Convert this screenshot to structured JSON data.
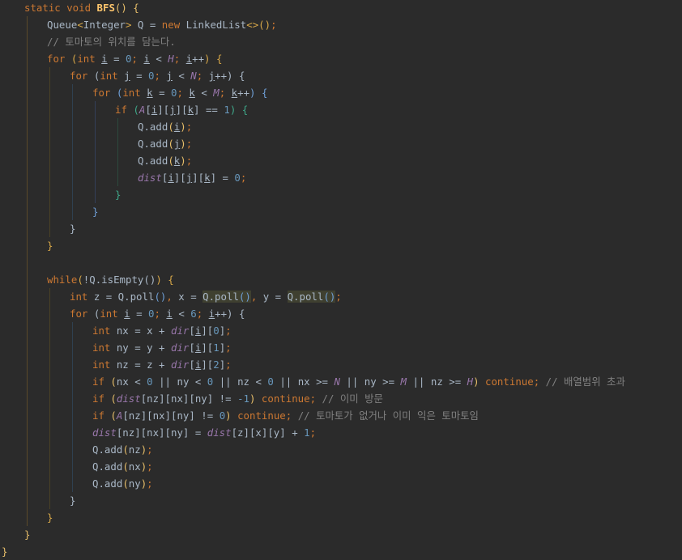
{
  "editor": {
    "colors": {
      "background": "#2b2b2b",
      "default": "#a9b7c6",
      "keyword": "#cc7832",
      "method": "#ffc66d",
      "number": "#6897bb",
      "comment": "#808080",
      "field": "#9876aa",
      "usage_highlight": "#3f4030"
    },
    "lines": [
      {
        "indent": 1,
        "tokens": [
          {
            "t": "static void ",
            "c": "kw"
          },
          {
            "t": "BFS",
            "c": "fn",
            "b": true
          },
          {
            "t": "() {",
            "c": "y0"
          }
        ]
      },
      {
        "indent": 2,
        "tokens": [
          {
            "t": "Queue",
            "c": "d"
          },
          {
            "t": "<",
            "c": "y1"
          },
          {
            "t": "Integer",
            "c": "d"
          },
          {
            "t": ">",
            "c": "y1"
          },
          {
            "t": " Q = ",
            "c": "d"
          },
          {
            "t": "new ",
            "c": "kw"
          },
          {
            "t": "LinkedList",
            "c": "d"
          },
          {
            "t": "<>",
            "c": "y1"
          },
          {
            "t": "()",
            "c": "y1"
          },
          {
            "t": ";",
            "c": "kw"
          }
        ]
      },
      {
        "indent": 2,
        "tokens": [
          {
            "t": "// 토마토의 위치를 담는다.",
            "c": "cm"
          }
        ]
      },
      {
        "indent": 2,
        "tokens": [
          {
            "t": "for ",
            "c": "kw"
          },
          {
            "t": "(",
            "c": "y1"
          },
          {
            "t": "int ",
            "c": "kw"
          },
          {
            "t": "i",
            "c": "d",
            "u": true
          },
          {
            "t": " = ",
            "c": "d"
          },
          {
            "t": "0",
            "c": "num"
          },
          {
            "t": "; ",
            "c": "kw"
          },
          {
            "t": "i",
            "c": "d",
            "u": true
          },
          {
            "t": " < ",
            "c": "d"
          },
          {
            "t": "H",
            "c": "f"
          },
          {
            "t": "; ",
            "c": "kw"
          },
          {
            "t": "i",
            "c": "d",
            "u": true
          },
          {
            "t": "++",
            "c": "d"
          },
          {
            "t": ") {",
            "c": "y1"
          }
        ]
      },
      {
        "indent": 3,
        "tokens": [
          {
            "t": "for ",
            "c": "kw"
          },
          {
            "t": "(",
            "c": "y2"
          },
          {
            "t": "int ",
            "c": "kw"
          },
          {
            "t": "j",
            "c": "d",
            "u": true
          },
          {
            "t": " = ",
            "c": "d"
          },
          {
            "t": "0",
            "c": "num"
          },
          {
            "t": "; ",
            "c": "kw"
          },
          {
            "t": "j",
            "c": "d",
            "u": true
          },
          {
            "t": " < ",
            "c": "d"
          },
          {
            "t": "N",
            "c": "f"
          },
          {
            "t": "; ",
            "c": "kw"
          },
          {
            "t": "j",
            "c": "d",
            "u": true
          },
          {
            "t": "++",
            "c": "d"
          },
          {
            "t": ") {",
            "c": "y2"
          }
        ]
      },
      {
        "indent": 4,
        "tokens": [
          {
            "t": "for ",
            "c": "kw"
          },
          {
            "t": "(",
            "c": "y3"
          },
          {
            "t": "int ",
            "c": "kw"
          },
          {
            "t": "k",
            "c": "d",
            "u": true
          },
          {
            "t": " = ",
            "c": "d"
          },
          {
            "t": "0",
            "c": "num"
          },
          {
            "t": "; ",
            "c": "kw"
          },
          {
            "t": "k",
            "c": "d",
            "u": true
          },
          {
            "t": " < ",
            "c": "d"
          },
          {
            "t": "M",
            "c": "f"
          },
          {
            "t": "; ",
            "c": "kw"
          },
          {
            "t": "k",
            "c": "d",
            "u": true
          },
          {
            "t": "++",
            "c": "d"
          },
          {
            "t": ") {",
            "c": "y3"
          }
        ]
      },
      {
        "indent": 5,
        "tokens": [
          {
            "t": "if ",
            "c": "kw"
          },
          {
            "t": "(",
            "c": "y4"
          },
          {
            "t": "A",
            "c": "f"
          },
          {
            "t": "[",
            "c": "d"
          },
          {
            "t": "i",
            "c": "d",
            "u": true
          },
          {
            "t": "][",
            "c": "d"
          },
          {
            "t": "j",
            "c": "d",
            "u": true
          },
          {
            "t": "][",
            "c": "d"
          },
          {
            "t": "k",
            "c": "d",
            "u": true
          },
          {
            "t": "] == ",
            "c": "d"
          },
          {
            "t": "1",
            "c": "num"
          },
          {
            "t": ") {",
            "c": "y4"
          }
        ]
      },
      {
        "indent": 6,
        "tokens": [
          {
            "t": "Q.add",
            "c": "d"
          },
          {
            "t": "(",
            "c": "y0"
          },
          {
            "t": "i",
            "c": "d",
            "u": true
          },
          {
            "t": ")",
            "c": "y0"
          },
          {
            "t": ";",
            "c": "kw"
          }
        ]
      },
      {
        "indent": 6,
        "tokens": [
          {
            "t": "Q.add",
            "c": "d"
          },
          {
            "t": "(",
            "c": "y0"
          },
          {
            "t": "j",
            "c": "d",
            "u": true
          },
          {
            "t": ")",
            "c": "y0"
          },
          {
            "t": ";",
            "c": "kw"
          }
        ]
      },
      {
        "indent": 6,
        "tokens": [
          {
            "t": "Q.add",
            "c": "d"
          },
          {
            "t": "(",
            "c": "y0"
          },
          {
            "t": "k",
            "c": "d",
            "u": true
          },
          {
            "t": ")",
            "c": "y0"
          },
          {
            "t": ";",
            "c": "kw"
          }
        ]
      },
      {
        "indent": 6,
        "tokens": [
          {
            "t": "dist",
            "c": "f"
          },
          {
            "t": "[",
            "c": "d"
          },
          {
            "t": "i",
            "c": "d",
            "u": true
          },
          {
            "t": "][",
            "c": "d"
          },
          {
            "t": "j",
            "c": "d",
            "u": true
          },
          {
            "t": "][",
            "c": "d"
          },
          {
            "t": "k",
            "c": "d",
            "u": true
          },
          {
            "t": "] = ",
            "c": "d"
          },
          {
            "t": "0",
            "c": "num"
          },
          {
            "t": ";",
            "c": "kw"
          }
        ]
      },
      {
        "indent": 5,
        "tokens": [
          {
            "t": "}",
            "c": "y4"
          }
        ]
      },
      {
        "indent": 4,
        "tokens": [
          {
            "t": "}",
            "c": "y3"
          }
        ]
      },
      {
        "indent": 3,
        "tokens": [
          {
            "t": "}",
            "c": "y2"
          }
        ]
      },
      {
        "indent": 2,
        "tokens": [
          {
            "t": "}",
            "c": "y1"
          }
        ]
      },
      {
        "indent": 0,
        "tokens": []
      },
      {
        "indent": 2,
        "tokens": [
          {
            "t": "while",
            "c": "kw"
          },
          {
            "t": "(",
            "c": "y1"
          },
          {
            "t": "!Q.isEmpty",
            "c": "d"
          },
          {
            "t": "()",
            "c": "y2"
          },
          {
            "t": ") {",
            "c": "y1"
          }
        ]
      },
      {
        "indent": 3,
        "tokens": [
          {
            "t": "int ",
            "c": "kw"
          },
          {
            "t": "z = Q.poll",
            "c": "d"
          },
          {
            "t": "()",
            "c": "y3"
          },
          {
            "t": ", ",
            "c": "kw"
          },
          {
            "t": "x = ",
            "c": "d"
          },
          {
            "t": "Q.poll",
            "c": "d",
            "h": true
          },
          {
            "t": "()",
            "c": "y3",
            "h": true
          },
          {
            "t": ", ",
            "c": "kw"
          },
          {
            "t": "y = ",
            "c": "d"
          },
          {
            "t": "Q.poll",
            "c": "d",
            "h": true
          },
          {
            "t": "()",
            "c": "y3",
            "h": true
          },
          {
            "t": ";",
            "c": "kw"
          }
        ]
      },
      {
        "indent": 3,
        "tokens": [
          {
            "t": "for ",
            "c": "kw"
          },
          {
            "t": "(",
            "c": "y2"
          },
          {
            "t": "int ",
            "c": "kw"
          },
          {
            "t": "i",
            "c": "d",
            "u": true
          },
          {
            "t": " = ",
            "c": "d"
          },
          {
            "t": "0",
            "c": "num"
          },
          {
            "t": "; ",
            "c": "kw"
          },
          {
            "t": "i",
            "c": "d",
            "u": true
          },
          {
            "t": " < ",
            "c": "d"
          },
          {
            "t": "6",
            "c": "num"
          },
          {
            "t": "; ",
            "c": "kw"
          },
          {
            "t": "i",
            "c": "d",
            "u": true
          },
          {
            "t": "++",
            "c": "d"
          },
          {
            "t": ") {",
            "c": "y2"
          }
        ]
      },
      {
        "indent": 4,
        "tokens": [
          {
            "t": "int ",
            "c": "kw"
          },
          {
            "t": "nx = x + ",
            "c": "d"
          },
          {
            "t": "dir",
            "c": "f"
          },
          {
            "t": "[",
            "c": "d"
          },
          {
            "t": "i",
            "c": "d",
            "u": true
          },
          {
            "t": "][",
            "c": "d"
          },
          {
            "t": "0",
            "c": "num"
          },
          {
            "t": "]",
            "c": "d"
          },
          {
            "t": ";",
            "c": "kw"
          }
        ]
      },
      {
        "indent": 4,
        "tokens": [
          {
            "t": "int ",
            "c": "kw"
          },
          {
            "t": "ny = y + ",
            "c": "d"
          },
          {
            "t": "dir",
            "c": "f"
          },
          {
            "t": "[",
            "c": "d"
          },
          {
            "t": "i",
            "c": "d",
            "u": true
          },
          {
            "t": "][",
            "c": "d"
          },
          {
            "t": "1",
            "c": "num"
          },
          {
            "t": "]",
            "c": "d"
          },
          {
            "t": ";",
            "c": "kw"
          }
        ]
      },
      {
        "indent": 4,
        "tokens": [
          {
            "t": "int ",
            "c": "kw"
          },
          {
            "t": "nz = z + ",
            "c": "d"
          },
          {
            "t": "dir",
            "c": "f"
          },
          {
            "t": "[",
            "c": "d"
          },
          {
            "t": "i",
            "c": "d",
            "u": true
          },
          {
            "t": "][",
            "c": "d"
          },
          {
            "t": "2",
            "c": "num"
          },
          {
            "t": "]",
            "c": "d"
          },
          {
            "t": ";",
            "c": "kw"
          }
        ]
      },
      {
        "indent": 4,
        "tokens": [
          {
            "t": "if ",
            "c": "kw"
          },
          {
            "t": "(",
            "c": "y0"
          },
          {
            "t": "nx < ",
            "c": "d"
          },
          {
            "t": "0",
            "c": "num"
          },
          {
            "t": " || ny < ",
            "c": "d"
          },
          {
            "t": "0",
            "c": "num"
          },
          {
            "t": " || nz < ",
            "c": "d"
          },
          {
            "t": "0",
            "c": "num"
          },
          {
            "t": " || nx >= ",
            "c": "d"
          },
          {
            "t": "N",
            "c": "f"
          },
          {
            "t": " || ny >= ",
            "c": "d"
          },
          {
            "t": "M",
            "c": "f"
          },
          {
            "t": " || nz >= ",
            "c": "d"
          },
          {
            "t": "H",
            "c": "f"
          },
          {
            "t": ") ",
            "c": "y0"
          },
          {
            "t": "continue",
            "c": "kw"
          },
          {
            "t": "; ",
            "c": "kw"
          },
          {
            "t": "// 배열범위 초과",
            "c": "cm"
          }
        ]
      },
      {
        "indent": 4,
        "tokens": [
          {
            "t": "if ",
            "c": "kw"
          },
          {
            "t": "(",
            "c": "y0"
          },
          {
            "t": "dist",
            "c": "f"
          },
          {
            "t": "[nz][nx][ny] != ",
            "c": "d"
          },
          {
            "t": "-1",
            "c": "num"
          },
          {
            "t": ") ",
            "c": "y0"
          },
          {
            "t": "continue",
            "c": "kw"
          },
          {
            "t": "; ",
            "c": "kw"
          },
          {
            "t": "// 이미 방문",
            "c": "cm"
          }
        ]
      },
      {
        "indent": 4,
        "tokens": [
          {
            "t": "if ",
            "c": "kw"
          },
          {
            "t": "(",
            "c": "y0"
          },
          {
            "t": "A",
            "c": "f"
          },
          {
            "t": "[nz][nx][ny] != ",
            "c": "d"
          },
          {
            "t": "0",
            "c": "num"
          },
          {
            "t": ") ",
            "c": "y0"
          },
          {
            "t": "continue",
            "c": "kw"
          },
          {
            "t": "; ",
            "c": "kw"
          },
          {
            "t": "// 토마토가 없거나 이미 익은 토마토임",
            "c": "cm"
          }
        ]
      },
      {
        "indent": 4,
        "tokens": [
          {
            "t": "dist",
            "c": "f"
          },
          {
            "t": "[nz][nx][ny] = ",
            "c": "d"
          },
          {
            "t": "dist",
            "c": "f"
          },
          {
            "t": "[z][x][y] + ",
            "c": "d"
          },
          {
            "t": "1",
            "c": "num"
          },
          {
            "t": ";",
            "c": "kw"
          }
        ]
      },
      {
        "indent": 4,
        "tokens": [
          {
            "t": "Q.add",
            "c": "d"
          },
          {
            "t": "(",
            "c": "y0"
          },
          {
            "t": "nz",
            "c": "d"
          },
          {
            "t": ")",
            "c": "y0"
          },
          {
            "t": ";",
            "c": "kw"
          }
        ]
      },
      {
        "indent": 4,
        "tokens": [
          {
            "t": "Q.add",
            "c": "d"
          },
          {
            "t": "(",
            "c": "y0"
          },
          {
            "t": "nx",
            "c": "d"
          },
          {
            "t": ")",
            "c": "y0"
          },
          {
            "t": ";",
            "c": "kw"
          }
        ]
      },
      {
        "indent": 4,
        "tokens": [
          {
            "t": "Q.add",
            "c": "d"
          },
          {
            "t": "(",
            "c": "y0"
          },
          {
            "t": "ny",
            "c": "d"
          },
          {
            "t": ")",
            "c": "y0"
          },
          {
            "t": ";",
            "c": "kw"
          }
        ]
      },
      {
        "indent": 3,
        "tokens": [
          {
            "t": "}",
            "c": "y2"
          }
        ]
      },
      {
        "indent": 2,
        "tokens": [
          {
            "t": "}",
            "c": "y1"
          }
        ]
      },
      {
        "indent": 1,
        "tokens": [
          {
            "t": "}",
            "c": "y0"
          }
        ]
      },
      {
        "indent": 0,
        "tokens": [
          {
            "t": "}",
            "c": "y0"
          }
        ]
      }
    ]
  }
}
